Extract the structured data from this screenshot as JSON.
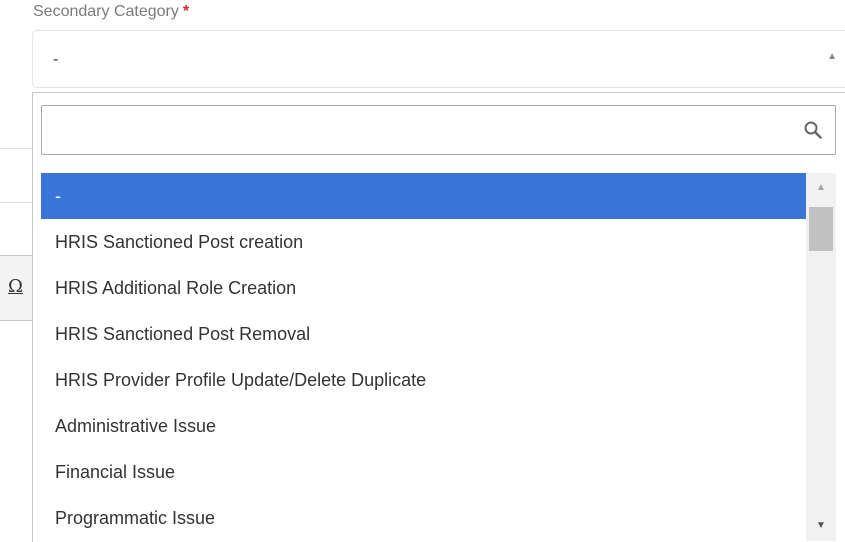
{
  "field": {
    "label": "Secondary Category",
    "required_mark": "*",
    "selected_value": "-",
    "arrow": "▲"
  },
  "background": {
    "toolbar_glyph": "Ω"
  },
  "dropdown": {
    "search": {
      "value": "",
      "placeholder": "",
      "icon": "search-icon"
    },
    "options": [
      {
        "label": "-",
        "selected": true
      },
      {
        "label": "HRIS Sanctioned Post creation"
      },
      {
        "label": "HRIS Additional Role Creation"
      },
      {
        "label": "HRIS Sanctioned Post Removal"
      },
      {
        "label": "HRIS Provider Profile Update/Delete Duplicate"
      },
      {
        "label": "Administrative Issue"
      },
      {
        "label": "Financial Issue"
      },
      {
        "label": "Programmatic Issue"
      }
    ],
    "scrollbar": {
      "up_arrow": "▲",
      "down_arrow": "▼"
    }
  },
  "colors": {
    "selected_bg": "#3875d7",
    "selected_text": "#ffffff",
    "required": "#e0202a",
    "label_text": "#7a7a7a"
  }
}
